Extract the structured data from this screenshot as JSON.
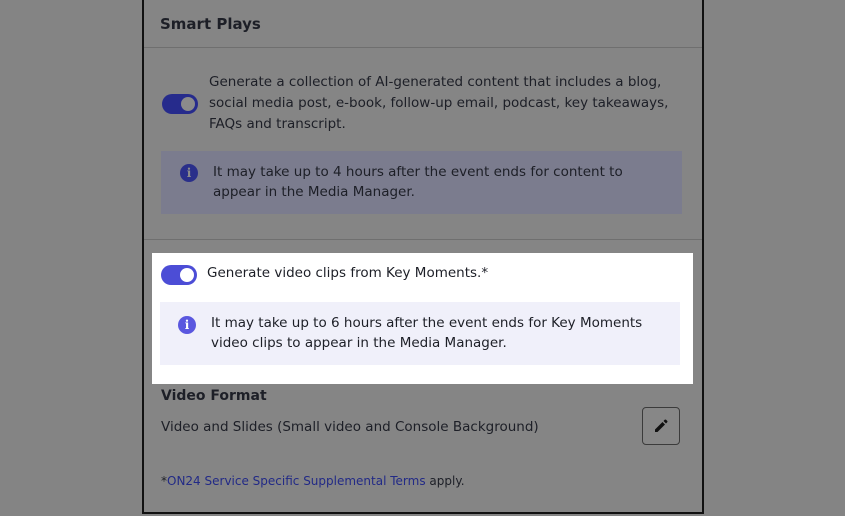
{
  "smart_plays": {
    "title": "Smart Plays",
    "ai_content": {
      "enabled": true,
      "description": "Generate a collection of AI-generated content that includes a blog, social media post, e-book, follow-up email, podcast, key takeaways, FAQs and transcript.",
      "info_icon": "info-icon",
      "info_text": "It may take up to 4 hours after the event ends for content to appear in the Media Manager."
    },
    "video_clips": {
      "enabled": true,
      "label": "Generate video clips from Key Moments.*",
      "info_icon": "info-icon",
      "info_text": "It may take up to 6 hours after the event ends for Key Moments video clips to appear in the Media Manager."
    },
    "video_format": {
      "title": "Video Format",
      "value": "Video and Slides (Small video and Console Background)",
      "edit_icon": "pencil-icon"
    },
    "terms": {
      "prefix": "*",
      "link_text": "ON24 Service Specific Supplemental Terms",
      "suffix": " apply."
    }
  },
  "colors": {
    "overlay": "#848484",
    "toggle_on": "#4c4dd6",
    "info_icon": "#5a57df",
    "info_box": "#f0f0fa",
    "link": "#222a86"
  }
}
